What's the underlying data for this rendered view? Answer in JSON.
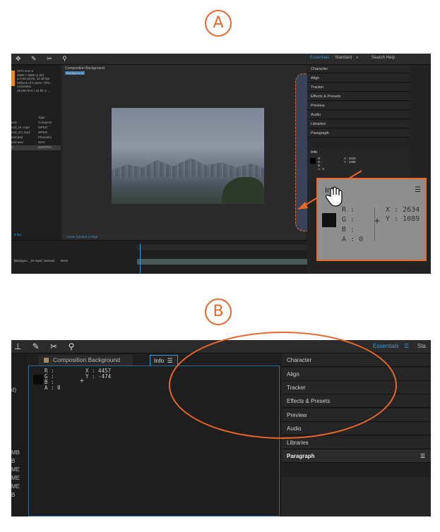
{
  "step_a": "A",
  "step_b": "B",
  "colors": {
    "accent": "#e8672a",
    "active_workspace": "#3a9ad9"
  },
  "panel_a": {
    "toolbar_icons": [
      "move-icon",
      "pen-icon",
      "puppet-icon",
      "pin-icon"
    ],
    "workspaces": [
      "Essentials",
      "Standard"
    ],
    "search_label": "Search Help",
    "more_label": "»",
    "project_meta": [
      "UFO.mov ▾",
      "4096 × 2600 (1.00)",
      "Δ 0;00;10;00, 24.00 fps",
      "Millions of Colors+ (Pre...",
      "Animation",
      "48.000 kHz / 16 bit U ..."
    ],
    "project_rows": [
      {
        "name": "und",
        "type": "Composit"
      },
      {
        "name": "und_HI..mp4",
        "type": "MPEG"
      },
      {
        "name": "und_CC.mp4",
        "type": "MPEG"
      },
      {
        "name": "und.psd",
        "type": "Photosho"
      },
      {
        "name": "und.wav",
        "type": "WAV"
      },
      {
        "name": "o",
        "type": "QuickTim"
      }
    ],
    "project_type_header": "Type",
    "comp_breadcrumb": "Composition Background",
    "comp_tag": "Background",
    "comp_bottom": "Active Camera   1 View",
    "right_panels": [
      "Character",
      "Align",
      "Tracker",
      "Effects & Presets",
      "Preview",
      "Audio",
      "Libraries",
      "Paragraph"
    ],
    "info_small": {
      "title": "Info",
      "r": "R :",
      "g": "G :",
      "b": "B :",
      "a": "A : 0",
      "x": "X : 2634",
      "y": "Y : 1089"
    },
    "timeline_layer": "[Backgro..._HI.mp4]",
    "timeline_mode": "Normal",
    "timeline_none": "None",
    "bpc": "8 bpc"
  },
  "callout": {
    "title": "Info",
    "menu": "☰",
    "r": "R :",
    "g": "G :",
    "b": "B :",
    "a": "A : 0",
    "x": "X : 2634",
    "y": "Y : 1089",
    "cross": "+"
  },
  "panel_b": {
    "workspaces": [
      "Essentials",
      "Sta"
    ],
    "workspace_menu": "☰",
    "left_fragments": [
      "d)",
      "MB",
      "B",
      "ME",
      "ME",
      "ME",
      "B"
    ],
    "tab_composition": "Composition Background",
    "tab_info": "Info",
    "tab_info_menu": "☰",
    "info": {
      "r": "R :",
      "g": "G :",
      "b": "B :",
      "a": "A : 0",
      "x": "X : 4457",
      "y": "Y : -474",
      "cross": "+"
    },
    "right_panels": [
      "Character",
      "Align",
      "Tracker",
      "Effects & Presets",
      "Preview",
      "Audio",
      "Libraries",
      "Paragraph"
    ],
    "paragraph_menu": "☰"
  }
}
